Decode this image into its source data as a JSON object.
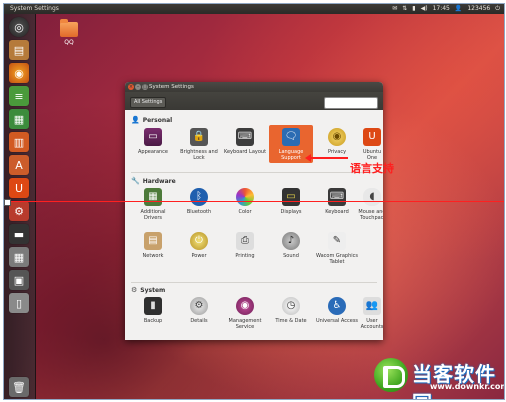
{
  "panel": {
    "title": "System Settings",
    "time": "17:45",
    "user": "123456",
    "icons": [
      "envelope-icon",
      "network-icon",
      "battery-icon",
      "volume-icon",
      "power-icon"
    ]
  },
  "desktop": {
    "folder_label": "QQ"
  },
  "window": {
    "title": "System Settings",
    "all_settings": "All Settings",
    "search_placeholder": "",
    "sections": [
      {
        "name": "Personal",
        "items": [
          "Appearance",
          "Brightness and Lock",
          "Keyboard Layout",
          "Language Support",
          "Privacy",
          "Ubuntu One"
        ]
      },
      {
        "name": "Hardware",
        "items": [
          "Additional Drivers",
          "Bluetooth",
          "Color",
          "Displays",
          "Keyboard",
          "Mouse and Touchpad",
          "Network",
          "Power",
          "Printing",
          "Sound",
          "Wacom Graphics Tablet"
        ]
      },
      {
        "name": "System",
        "items": [
          "Backup",
          "Details",
          "Management Service",
          "Time & Date",
          "Universal Access",
          "User Accounts"
        ]
      }
    ]
  },
  "annotation": {
    "text": "语言支持",
    "color": "#ff1e1e"
  },
  "watermark": {
    "name": "当客软件园",
    "url": "www.downkr.com"
  },
  "colors": {
    "highlight": "#e9652f",
    "panel": "#3c3b37"
  }
}
